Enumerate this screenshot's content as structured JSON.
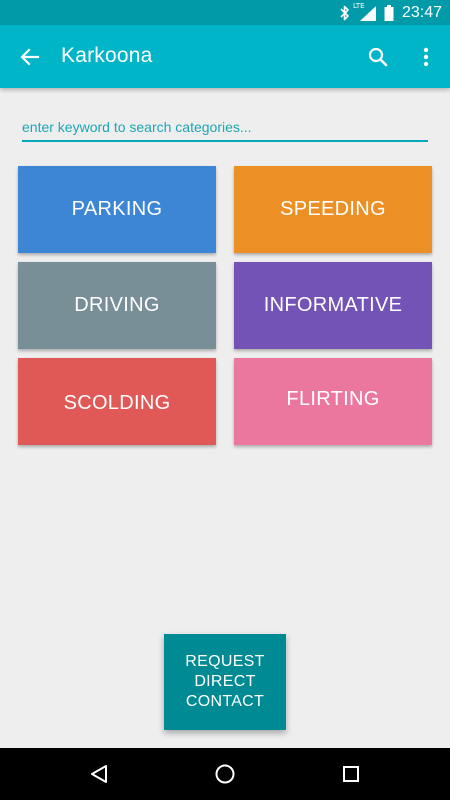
{
  "status_bar": {
    "network_label": "LTE",
    "time": "23:47",
    "icons": [
      "bluetooth-icon",
      "signal-icon",
      "battery-icon"
    ]
  },
  "app_bar": {
    "title": "Karkoona",
    "back_icon": "arrow-back-icon",
    "search_icon": "search-icon",
    "more_icon": "more-vert-icon"
  },
  "search": {
    "placeholder": "enter keyword to search categories...",
    "value": ""
  },
  "categories": [
    {
      "label": "PARKING",
      "color": "#3d86d6"
    },
    {
      "label": "SPEEDING",
      "color": "#ec9026"
    },
    {
      "label": "DRIVING",
      "color": "#788f98"
    },
    {
      "label": "INFORMATIVE",
      "color": "#7453b6"
    },
    {
      "label": "SCOLDING",
      "color": "#e15957"
    },
    {
      "label": "FLIRTING",
      "color": "#eb779f"
    }
  ],
  "request_button": {
    "label": "REQUEST\nDIRECT\nCONTACT",
    "color": "#008b94"
  },
  "colors": {
    "status_bar": "#009aa8",
    "app_bar": "#00b5c7",
    "background": "#eeeeee",
    "accent": "#00a9bb"
  },
  "nav_bar": {
    "icons": [
      "nav-back-icon",
      "nav-home-icon",
      "nav-recents-icon"
    ]
  }
}
